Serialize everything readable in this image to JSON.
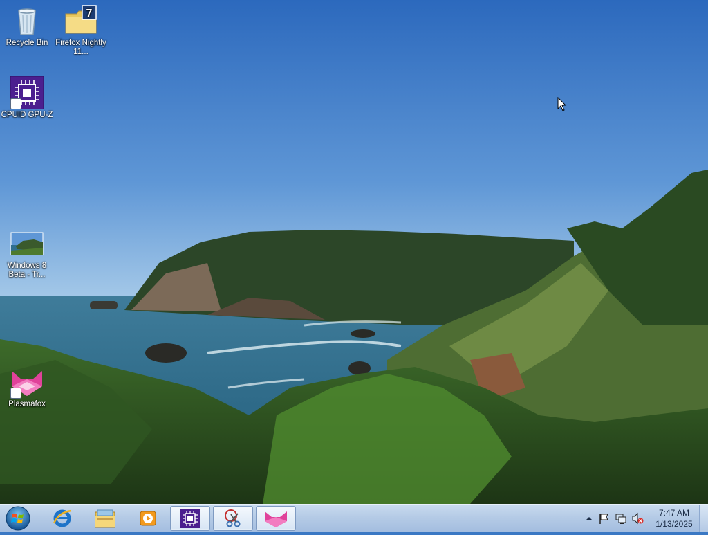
{
  "desktop": {
    "icons": [
      {
        "label": "Recycle Bin"
      },
      {
        "label": "Firefox Nightly 11..."
      },
      {
        "label": "CPUID GPU-Z"
      },
      {
        "label": "Windows 8 Beta - Tr..."
      },
      {
        "label": "Plasmafox"
      }
    ]
  },
  "taskbar": {
    "clock": {
      "time": "7:47 AM",
      "date": "1/13/2025"
    }
  },
  "colors": {
    "sky_top": "#2e6bbf",
    "sky_bottom": "#8bb9e6",
    "sea": "#2f6e8f",
    "taskbar": "#b5cbe6",
    "gpuz_purple": "#4b1f8f",
    "plasmafox_pink": "#e0429a"
  },
  "icons": {
    "recycle_bin": "recycle-bin-icon",
    "firefox_nightly": "folder-icon",
    "gpuz": "chip-icon",
    "windows8": "landscape-thumbnail-icon",
    "plasmafox": "plasmafox-icon",
    "start": "windows-orb-icon",
    "ie": "internet-explorer-icon",
    "explorer": "folder-library-icon",
    "media_player": "media-player-icon",
    "snipping": "scissors-icon",
    "tray_arrow": "chevron-up-icon",
    "tray_flag": "action-center-flag-icon",
    "tray_network": "network-icon",
    "tray_volume": "volume-muted-icon"
  }
}
